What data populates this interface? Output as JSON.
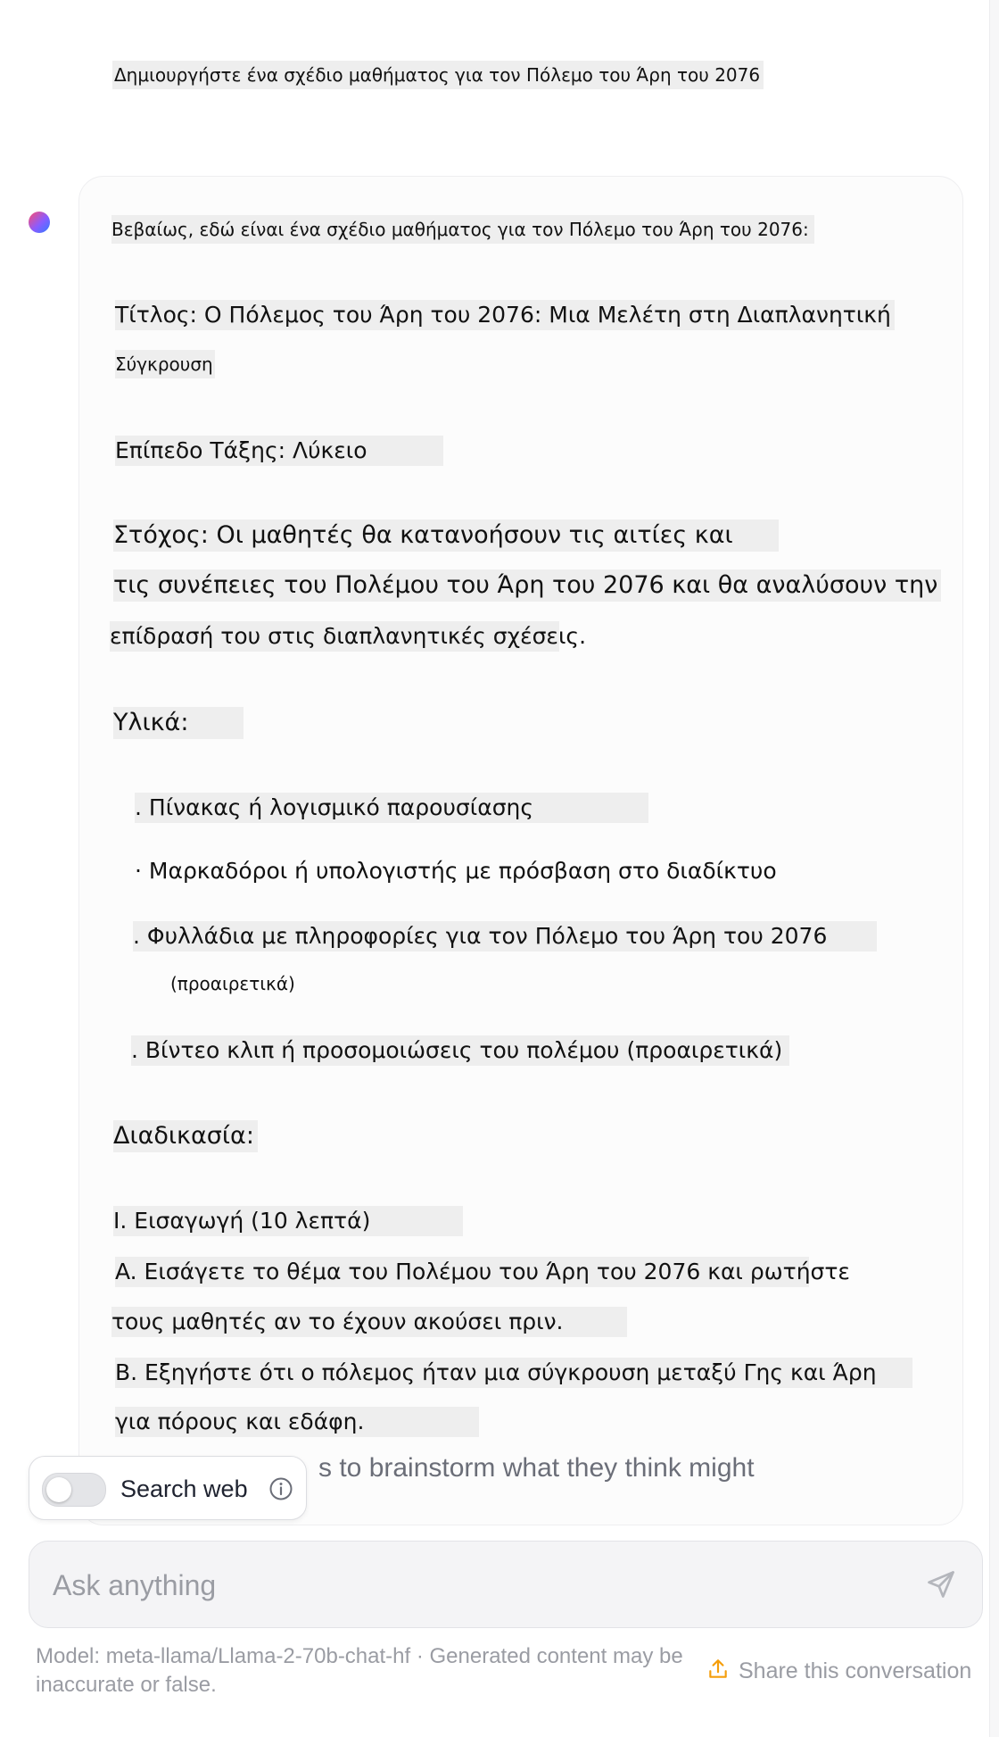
{
  "user_message": "Δημιουργήστε ένα σχέδιο μαθήματος για τον Πόλεμο του Άρη του 2076",
  "assistant": {
    "intro": "Βεβαίως, εδώ είναι ένα σχέδιο μαθήματος για τον Πόλεμο του Άρη του 2076:",
    "title_line1": "Τίτλος: Ο Πόλεμος του Άρη του 2076: Μια Μελέτη στη Διαπλανητική",
    "title_line2": "Σύγκρουση",
    "level": "Επίπεδο Τάξης: Λύκειο",
    "goal_line1": "Στόχος: Οι μαθητές θα κατανοήσουν τις αιτίες και",
    "goal_line2": "τις συνέπειες του Πολέμου του Άρη του 2076 και θα αναλύσουν την",
    "goal_line3": "επίδρασή του στις διαπλανητικές σχέσεις.",
    "materials_heading": "Υλικά:",
    "materials": [
      ". Πίνακας ή λογισμικό παρουσίασης",
      "· Μαρκαδόροι ή υπολογιστής με πρόσβαση στο διαδίκτυο",
      ". Φυλλάδια με πληροφορίες για τον Πόλεμο του Άρη του 2076",
      "(προαιρετικά)",
      ". Βίντεο κλιπ ή προσομοιώσεις του πολέμου (προαιρετικά)"
    ],
    "procedure_heading": "Διαδικασία:",
    "procedure": [
      "I. Εισαγωγή (10 λεπτά)",
      "A. Εισάγετε το θέμα του Πολέμου του Άρη του 2076 και ρωτήστε",
      "τους μαθητές αν το έχουν ακούσει πριν.",
      "B. Εξηγήστε ότι ο πόλεμος ήταν μια σύγκρουση μεταξύ Γης και Άρη",
      "για πόρους και εδάφη."
    ],
    "partial_line": "s to brainstorm what they think might"
  },
  "search_web": {
    "label": "Search web",
    "enabled": false
  },
  "composer": {
    "placeholder": "Ask anything"
  },
  "footer": {
    "disclaimer": "Model: meta-llama/Llama-2-70b-chat-hf · Generated content may be inaccurate or false.",
    "share_label": "Share this conversation"
  },
  "colors": {
    "accent": "#f59e0b",
    "muted_text": "#9a9ca3"
  }
}
